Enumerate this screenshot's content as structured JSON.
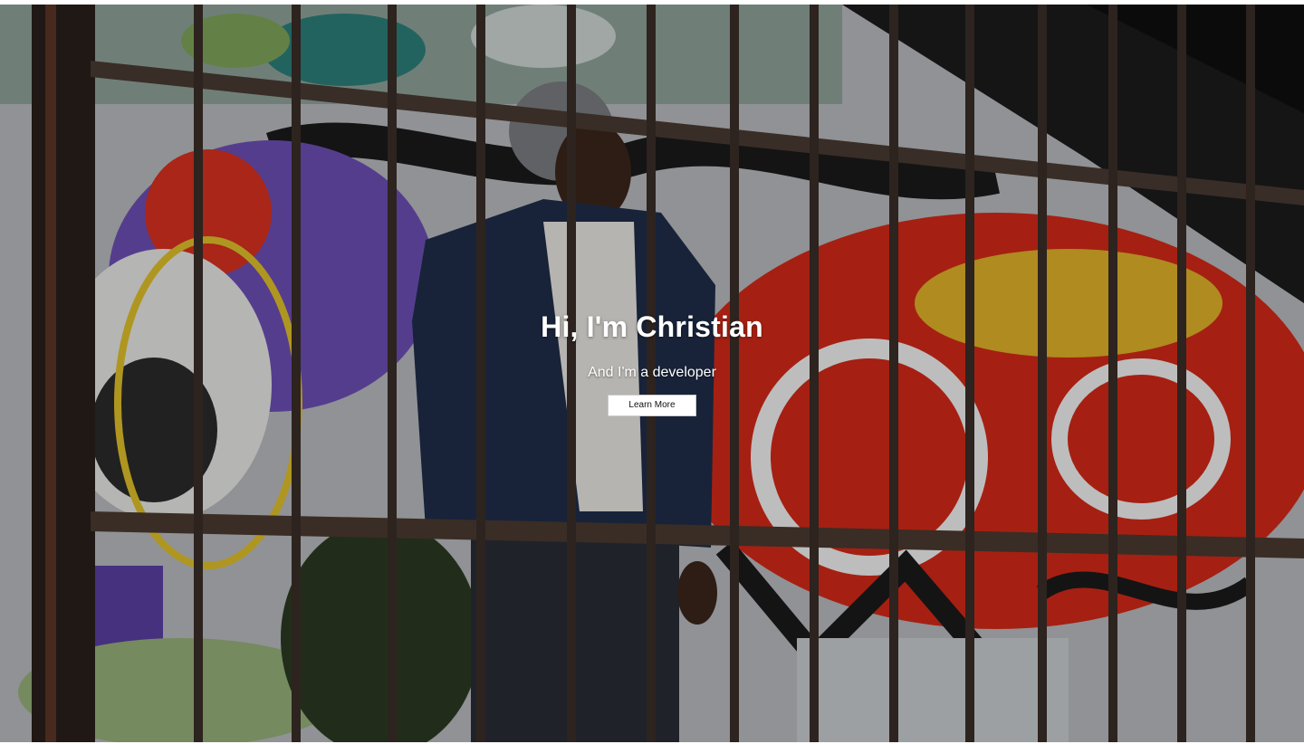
{
  "hero": {
    "title": "Hi, I'm Christian",
    "subtitle": "And I'm a developer",
    "cta_label": "Learn More"
  }
}
